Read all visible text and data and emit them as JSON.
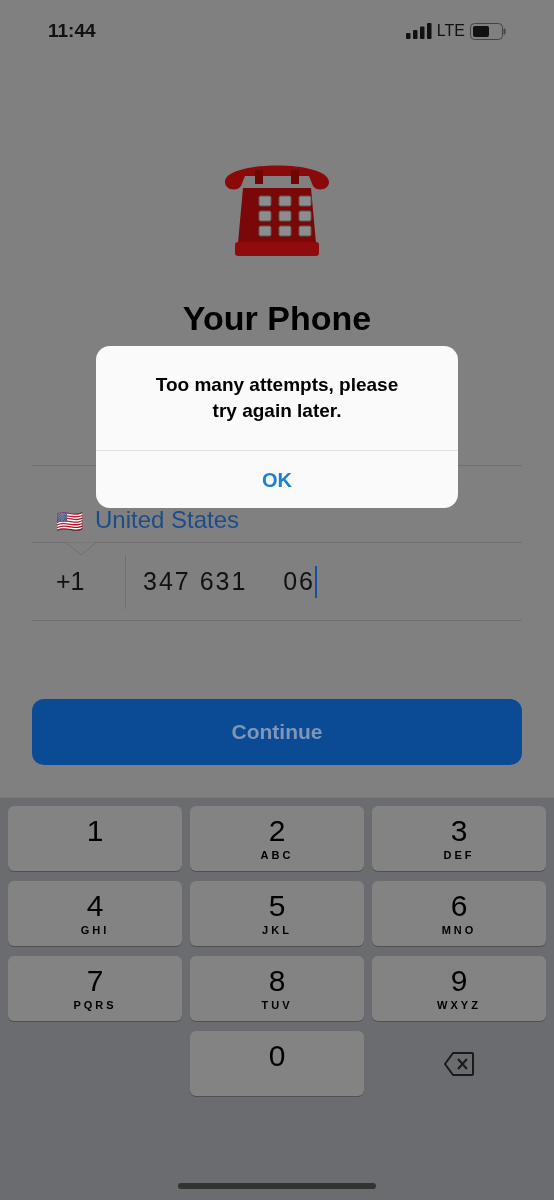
{
  "status_bar": {
    "time": "11:44",
    "network": "LTE"
  },
  "title": "Your Phone",
  "country": {
    "flag": "🇺🇸",
    "name": "United States"
  },
  "phone": {
    "code": "+1",
    "value": "347 631    06"
  },
  "continue_button": "Continue",
  "alert": {
    "message": "Too many attempts, please try again later.",
    "button": "OK"
  },
  "keypad": [
    {
      "kind": "digit",
      "digit": "1"
    },
    {
      "kind": "digit",
      "digit": "2",
      "letters": "ABC"
    },
    {
      "kind": "digit",
      "digit": "3",
      "letters": "DEF"
    },
    {
      "kind": "digit",
      "digit": "4",
      "letters": "GHI"
    },
    {
      "kind": "digit",
      "digit": "5",
      "letters": "JKL"
    },
    {
      "kind": "digit",
      "digit": "6",
      "letters": "MNO"
    },
    {
      "kind": "digit",
      "digit": "7",
      "letters": "PQRS"
    },
    {
      "kind": "digit",
      "digit": "8",
      "letters": "TUV"
    },
    {
      "kind": "digit",
      "digit": "9",
      "letters": "WXYZ"
    },
    {
      "kind": "blank"
    },
    {
      "kind": "digit",
      "digit": "0"
    },
    {
      "kind": "delete"
    }
  ]
}
